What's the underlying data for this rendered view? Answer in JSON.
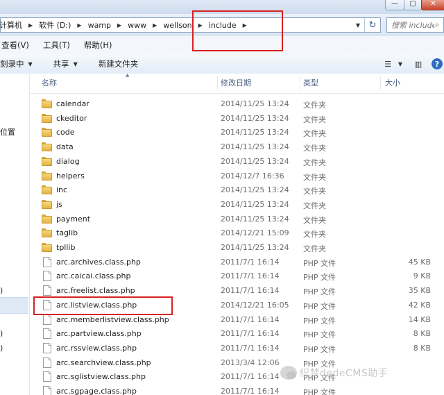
{
  "window": {
    "min_glyph": "—",
    "max_glyph": "▢",
    "close_glyph": "✕"
  },
  "address_bar": {
    "crumbs": [
      "计算机",
      "软件 (D:)",
      "wamp",
      "www",
      "wellson",
      "include"
    ],
    "dropdown_glyph": "▼",
    "refresh_glyph": "↻"
  },
  "search": {
    "placeholder": "搜索 include",
    "icon": "search-icon"
  },
  "menu": {
    "items": [
      "查看(V)",
      "工具(T)",
      "帮助(H)"
    ]
  },
  "toolbar": {
    "items": [
      {
        "label": "刻录中",
        "dropdown": true
      },
      {
        "label": "共享",
        "dropdown": true
      },
      {
        "label": "新建文件夹",
        "dropdown": false
      }
    ],
    "view_icons": [
      "change-view-icon",
      "preview-pane-icon",
      "help-icon"
    ]
  },
  "nav_pane": {
    "visible_fragments": [
      "位置",
      ")",
      ")",
      ")"
    ]
  },
  "columns": {
    "name": "名称",
    "date": "修改日期",
    "type": "类型",
    "size": "大小"
  },
  "files": [
    {
      "name": "calendar",
      "date": "2014/11/25 13:24",
      "type": "文件夹",
      "size": "",
      "kind": "folder"
    },
    {
      "name": "ckeditor",
      "date": "2014/11/25 13:24",
      "type": "文件夹",
      "size": "",
      "kind": "folder"
    },
    {
      "name": "code",
      "date": "2014/11/25 13:24",
      "type": "文件夹",
      "size": "",
      "kind": "folder"
    },
    {
      "name": "data",
      "date": "2014/11/25 13:24",
      "type": "文件夹",
      "size": "",
      "kind": "folder"
    },
    {
      "name": "dialog",
      "date": "2014/11/25 13:24",
      "type": "文件夹",
      "size": "",
      "kind": "folder"
    },
    {
      "name": "helpers",
      "date": "2014/12/7 16:36",
      "type": "文件夹",
      "size": "",
      "kind": "folder"
    },
    {
      "name": "inc",
      "date": "2014/11/25 13:24",
      "type": "文件夹",
      "size": "",
      "kind": "folder"
    },
    {
      "name": "js",
      "date": "2014/11/25 13:24",
      "type": "文件夹",
      "size": "",
      "kind": "folder"
    },
    {
      "name": "payment",
      "date": "2014/11/25 13:24",
      "type": "文件夹",
      "size": "",
      "kind": "folder"
    },
    {
      "name": "taglib",
      "date": "2014/12/21 15:09",
      "type": "文件夹",
      "size": "",
      "kind": "folder"
    },
    {
      "name": "tpllib",
      "date": "2014/11/25 13:24",
      "type": "文件夹",
      "size": "",
      "kind": "folder"
    },
    {
      "name": "arc.archives.class.php",
      "date": "2011/7/1 16:14",
      "type": "PHP 文件",
      "size": "45 KB",
      "kind": "file"
    },
    {
      "name": "arc.caicai.class.php",
      "date": "2011/7/1 16:14",
      "type": "PHP 文件",
      "size": "9 KB",
      "kind": "file"
    },
    {
      "name": "arc.freelist.class.php",
      "date": "2011/7/1 16:14",
      "type": "PHP 文件",
      "size": "35 KB",
      "kind": "file"
    },
    {
      "name": "arc.listview.class.php",
      "date": "2014/12/21 16:05",
      "type": "PHP 文件",
      "size": "42 KB",
      "kind": "file"
    },
    {
      "name": "arc.memberlistview.class.php",
      "date": "2011/7/1 16:14",
      "type": "PHP 文件",
      "size": "14 KB",
      "kind": "file"
    },
    {
      "name": "arc.partview.class.php",
      "date": "2011/7/1 16:14",
      "type": "PHP 文件",
      "size": "8 KB",
      "kind": "file"
    },
    {
      "name": "arc.rssview.class.php",
      "date": "2011/7/1 16:14",
      "type": "PHP 文件",
      "size": "8 KB",
      "kind": "file"
    },
    {
      "name": "arc.searchview.class.php",
      "date": "2013/3/4 12:06",
      "type": "PHP 文件",
      "size": "",
      "kind": "file"
    },
    {
      "name": "arc.sglistview.class.php",
      "date": "2011/7/1 16:14",
      "type": "PHP 文件",
      "size": "",
      "kind": "file"
    },
    {
      "name": "arc.sgpage.class.php",
      "date": "2011/7/1 16:14",
      "type": "PHP 文件",
      "size": "",
      "kind": "file"
    }
  ],
  "watermark": {
    "text": "织梦dedeCMS助手"
  },
  "colors": {
    "annotation_red": "#d9201f",
    "folder_yellow": "#e8be55",
    "header_text": "#4d6185"
  }
}
